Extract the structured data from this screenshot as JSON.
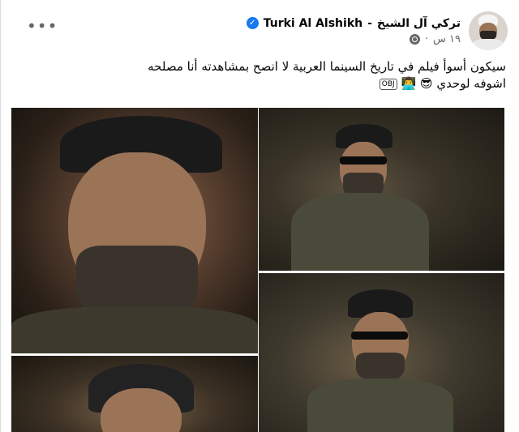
{
  "post": {
    "author_en": "Turki Al Alshikh",
    "separator": "-",
    "author_ar": "تركي آل الشيخ",
    "time": "١٩ س",
    "dot": "·",
    "text_line1": "سيكون أسوأ فيلم في تاريخ السينما العربية لا انصح بمشاهدته أنا مصلحه",
    "text_line2": "اشوفه لوحدي",
    "emoji_1": "😎",
    "emoji_2": "👨‍💻",
    "obj_label": "OBJ",
    "more_label": "•••"
  },
  "icons": {
    "verified": "verified-badge-icon",
    "globe": "globe-icon",
    "more": "more-options-icon"
  },
  "colors": {
    "verified": "#1877f2",
    "name": "#050505",
    "meta": "#65676b"
  }
}
